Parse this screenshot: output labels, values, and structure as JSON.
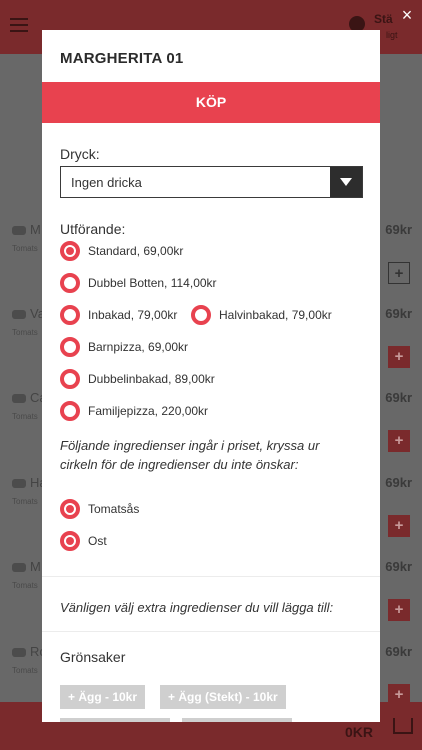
{
  "background": {
    "status_title": "Stä",
    "status_sub": "ligt",
    "rows": [
      {
        "name": "M",
        "sub": "Tomats",
        "price": "69kr"
      },
      {
        "name": "Va",
        "sub": "Tomats",
        "price": "69kr"
      },
      {
        "name": "Ca",
        "sub": "Tomats",
        "price": "69kr"
      },
      {
        "name": "Ha",
        "sub": "Tomats",
        "price": "69kr"
      },
      {
        "name": "M",
        "sub": "Tomats",
        "price": "69kr"
      },
      {
        "name": "Ro",
        "sub": "Tomats",
        "price": "69kr"
      }
    ],
    "plus_symbol": "+",
    "total": "0KR"
  },
  "modal": {
    "close_symbol": "×",
    "title": "MARGHERITA 01",
    "buy_label": "KÖP",
    "drink_label": "Dryck:",
    "drink_value": "Ingen dricka",
    "style_label": "Utförande:",
    "styles": [
      {
        "label": "Standard, 69,00kr",
        "selected": true
      },
      {
        "label": "Dubbel Botten, 114,00kr",
        "selected": false
      },
      {
        "label": "Inbakad, 79,00kr",
        "selected": false
      },
      {
        "label": "Halvinbakad, 79,00kr",
        "selected": false
      },
      {
        "label": "Barnpizza, 69,00kr",
        "selected": false
      },
      {
        "label": "Dubbelinbakad, 89,00kr",
        "selected": false
      },
      {
        "label": "Familjepizza, 220,00kr",
        "selected": false
      }
    ],
    "included_info": "Följande ingredienser ingår i priset, kryssa ur cirkeln för de ingredienser du inte önskar:",
    "ingredients": [
      {
        "label": "Tomatsås",
        "selected": true
      },
      {
        "label": "Ost",
        "selected": true
      }
    ],
    "extra_info": "Vänligen välj extra ingredienser du vill lägga till:",
    "extra_category": "Grönsaker",
    "extras": [
      {
        "label": "+ Ägg - 10kr"
      },
      {
        "label": "+ Ägg (Stekt) - 10kr"
      }
    ]
  },
  "colors": {
    "accent": "#e8424f",
    "dark": "#2d2d2d"
  }
}
